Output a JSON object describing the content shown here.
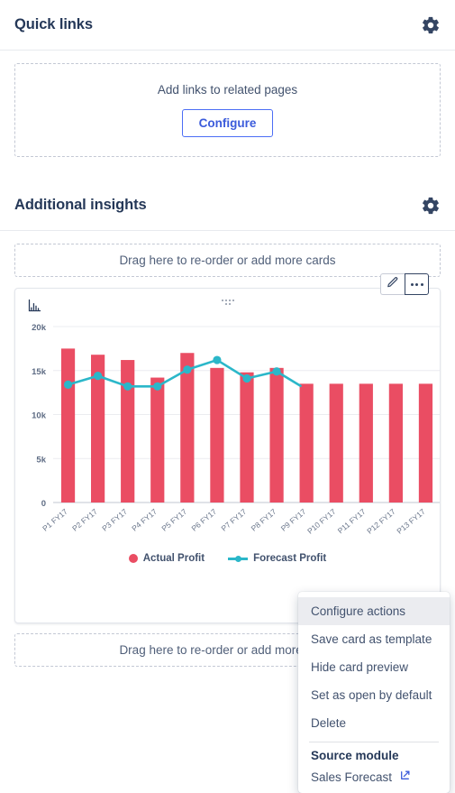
{
  "quick_links": {
    "title": "Quick links",
    "gear_icon": "gear-icon",
    "empty_text": "Add links to related pages",
    "configure_label": "Configure"
  },
  "additional_insights": {
    "title": "Additional insights",
    "gear_icon": "gear-icon",
    "dropzone_top": "Drag here to re-order or add more cards",
    "dropzone_bottom": "Drag here to re-order or add more cards"
  },
  "card": {
    "chart_icon": "bar-chart-icon",
    "drag_handle_icon": "drag-handle-icon",
    "edit_icon": "pencil-icon",
    "more_icon": "more-horizontal-icon"
  },
  "menu": {
    "items": [
      {
        "label": "Configure actions",
        "highlighted": true
      },
      {
        "label": "Save card as template",
        "highlighted": false
      },
      {
        "label": "Hide card preview",
        "highlighted": false
      },
      {
        "label": "Set as open by default",
        "highlighted": false
      },
      {
        "label": "Delete",
        "highlighted": false
      }
    ],
    "source_module_heading": "Source module",
    "source_module_name": "Sales Forecast",
    "external_link_icon": "external-link-icon"
  },
  "colors": {
    "actual": "#ea4d63",
    "forecast": "#2bb7c9",
    "accent_blue": "#3b5bdb",
    "heading": "#253858",
    "text": "#42526e",
    "grid": "#ebecf0"
  },
  "chart_data": {
    "type": "bar",
    "title": "",
    "xlabel": "",
    "ylabel": "",
    "ylim": [
      0,
      20000
    ],
    "yticks": [
      0,
      5000,
      10000,
      15000,
      20000
    ],
    "ytick_labels": [
      "0",
      "5k",
      "10k",
      "15k",
      "20k"
    ],
    "grid": true,
    "legend_position": "bottom",
    "categories": [
      "P1 FY17",
      "P2 FY17",
      "P3 FY17",
      "P4 FY17",
      "P5 FY17",
      "P6 FY17",
      "P7 FY17",
      "P8 FY17",
      "P9 FY17",
      "P10 FY17",
      "P11 FY17",
      "P12 FY17",
      "P13 FY17"
    ],
    "series": [
      {
        "name": "Actual Profit",
        "type": "bar",
        "color": "#ea4d63",
        "values": [
          17500,
          16800,
          16200,
          14200,
          17000,
          15300,
          14800,
          15300,
          13500,
          13500,
          13500,
          13500,
          13500
        ]
      },
      {
        "name": "Forecast Profit",
        "type": "line",
        "color": "#2bb7c9",
        "values": [
          13400,
          14400,
          13200,
          13200,
          15100,
          16200,
          14100,
          14900,
          null,
          null,
          null,
          null,
          null
        ]
      }
    ]
  }
}
